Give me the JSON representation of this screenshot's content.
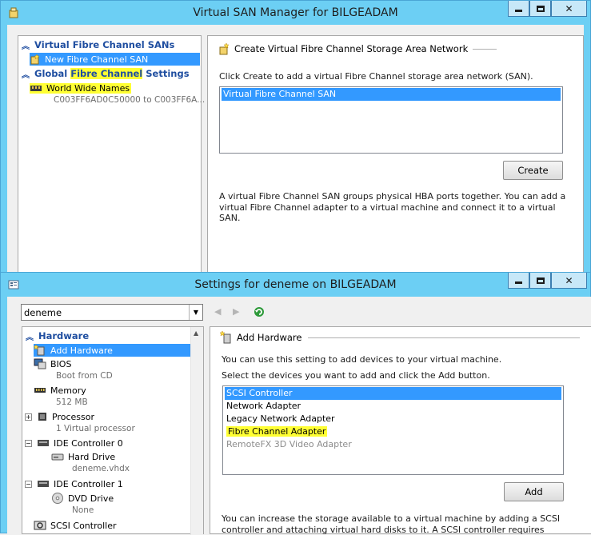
{
  "san_manager": {
    "title": "Virtual SAN Manager for BILGEADAM",
    "tree": {
      "cat_sans": "Virtual Fibre Channel SANs",
      "new_san": "New Fibre Channel SAN",
      "cat_global_pre": "Global ",
      "cat_global_hl": "Fibre Channel",
      "cat_global_post": " Settings",
      "wwn": "World Wide Names",
      "wwn_range": "C003FF6AD0C50000 to C003FF6A..."
    },
    "right": {
      "group_title": "Create Virtual Fibre Channel Storage Area Network",
      "instruction": "Click Create to add a virtual Fibre Channel storage area network (SAN).",
      "list_items": [
        "Virtual Fibre Channel SAN"
      ],
      "create_label": "Create",
      "description": "A virtual Fibre Channel SAN groups physical HBA ports together. You can add a virtual Fibre Channel adapter to a virtual machine and connect it to a virtual SAN."
    }
  },
  "settings": {
    "title": "Settings for deneme on BILGEADAM",
    "vm_select": "deneme",
    "hardware": {
      "category": "Hardware",
      "add_hardware": "Add Hardware",
      "bios": "BIOS",
      "bios_sub": "Boot from CD",
      "memory": "Memory",
      "memory_sub": "512 MB",
      "processor": "Processor",
      "processor_sub": "1 Virtual processor",
      "ide0": "IDE Controller 0",
      "hard_drive": "Hard Drive",
      "hard_drive_sub": "deneme.vhdx",
      "ide1": "IDE Controller 1",
      "dvd": "DVD Drive",
      "dvd_sub": "None",
      "scsi": "SCSI Controller"
    },
    "right": {
      "group_title": "Add Hardware",
      "line1": "You can use this setting to add devices to your virtual machine.",
      "line2": "Select the devices you want to add and click the Add button.",
      "devices": [
        "SCSI Controller",
        "Network Adapter",
        "Legacy Network Adapter",
        "Fibre Channel Adapter",
        "RemoteFX 3D Video Adapter"
      ],
      "add_label": "Add",
      "description": "You can increase the storage available to a virtual machine by adding a SCSI controller and attaching virtual hard disks to it. A SCSI controller requires integration services in the guest operating system. Do not attach a system disk to a SCSI controller. System disks must be attached to an IDE controller."
    }
  },
  "caption_buttons": {
    "minimize": "▁",
    "maximize": "☐",
    "close": "✕"
  }
}
